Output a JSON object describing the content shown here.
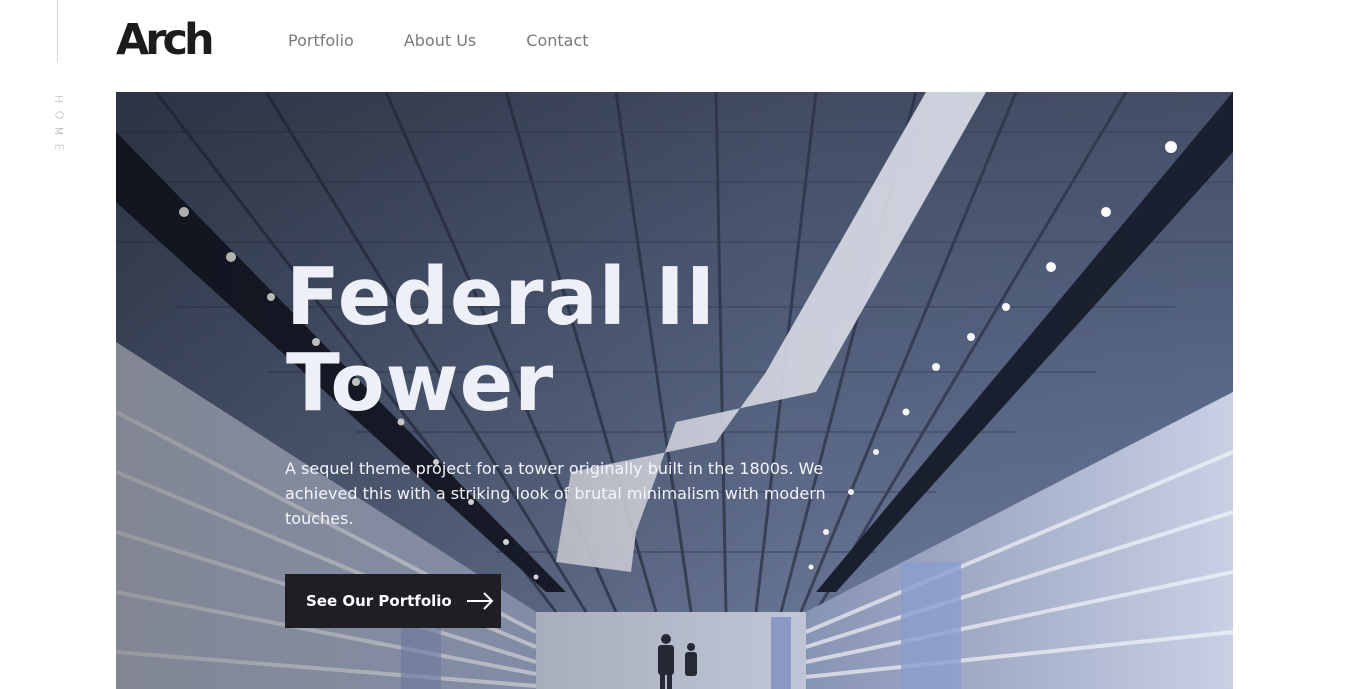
{
  "sidebar": {
    "label": [
      "H",
      "O",
      "M",
      "E"
    ]
  },
  "header": {
    "logo": "Arch",
    "nav": [
      {
        "label": "Portfolio"
      },
      {
        "label": "About Us"
      },
      {
        "label": "Contact"
      }
    ]
  },
  "hero": {
    "title_line1": "Federal II",
    "title_line2": "Tower",
    "description": "A sequel theme project for a tower originally built in the 1800s. We achieved this with a striking look of brutal minimalism with modern touches.",
    "cta_label": "See Our Portfolio",
    "cta_icon": "arrow-right-icon"
  },
  "colors": {
    "text_dark": "#1c1c1c",
    "nav_text": "#7a7a7a",
    "button_bg": "#1d1f24",
    "hero_text": "#eef0f8"
  }
}
